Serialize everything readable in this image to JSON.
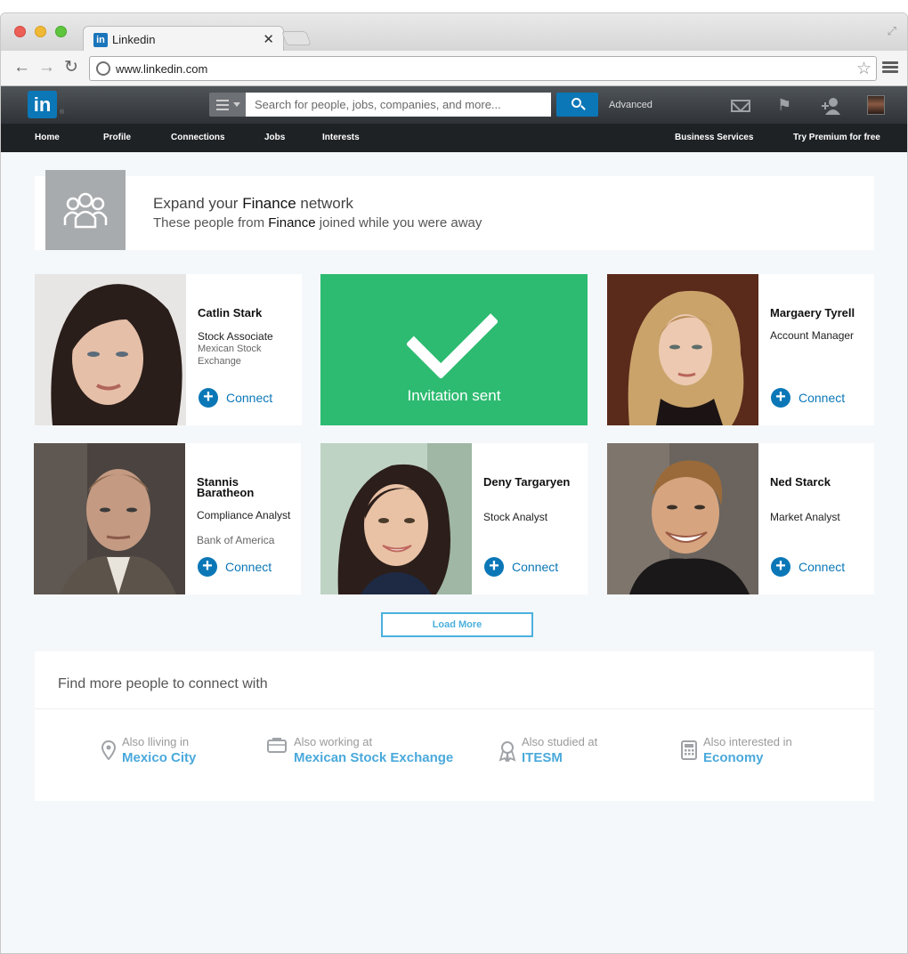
{
  "browser": {
    "tab_title": "Linkedin",
    "tab_favicon": "in",
    "url": "www.linkedin.com",
    "icons": [
      "back-arrow-icon",
      "forward-arrow-icon",
      "reload-icon",
      "globe-icon",
      "star-icon",
      "menu-icon",
      "close-icon",
      "resize-icon"
    ]
  },
  "header": {
    "logo": "in",
    "search_placeholder": "Search for people, jobs, companies, and more...",
    "advanced_label": "Advanced"
  },
  "nav": {
    "items": [
      "Home",
      "Profile",
      "Connections",
      "Jobs",
      "Interests"
    ],
    "right_items": [
      "Business Services",
      "Try Premium for free"
    ]
  },
  "banner": {
    "title_prefix": "Expand your ",
    "title_highlight": "Finance",
    "title_suffix": " network",
    "sub_prefix": "These people from ",
    "sub_highlight": "Finance",
    "sub_suffix": " joined while you were away"
  },
  "cards": [
    {
      "name": "Catlin Stark",
      "title": "Stock Associate",
      "company": "Mexican Stock Exchange",
      "connect": "Connect"
    },
    {
      "name": "Margaery Tyrell",
      "title": "Account Manager",
      "company": "",
      "connect": "Connect"
    },
    {
      "name": "Stannis Baratheon",
      "title": "Compliance Analyst",
      "company": "Bank of America",
      "connect": "Connect"
    },
    {
      "name": "Deny Targaryen",
      "title": "Stock Analyst",
      "company": "",
      "connect": "Connect"
    },
    {
      "name": "Ned Starck",
      "title": "Market Analyst",
      "company": "",
      "connect": "Connect"
    }
  ],
  "invitation": {
    "text": "Invitation sent"
  },
  "load_more": "Load More",
  "find_more": {
    "title": "Find more people to connect with",
    "items": [
      {
        "label": "Also lliving in",
        "value": "Mexico City",
        "icon": "location-pin-icon"
      },
      {
        "label": "Also working at",
        "value": "Mexican Stock Exchange",
        "icon": "briefcase-icon"
      },
      {
        "label": "Also studied at",
        "value": "ITESM",
        "icon": "ribbon-award-icon"
      },
      {
        "label": "Also interested in",
        "value": "Economy",
        "icon": "calculator-icon"
      }
    ]
  },
  "colors": {
    "brand": "#0b77b7",
    "invite_green": "#2dbb71",
    "link": "#4aa9dc"
  }
}
